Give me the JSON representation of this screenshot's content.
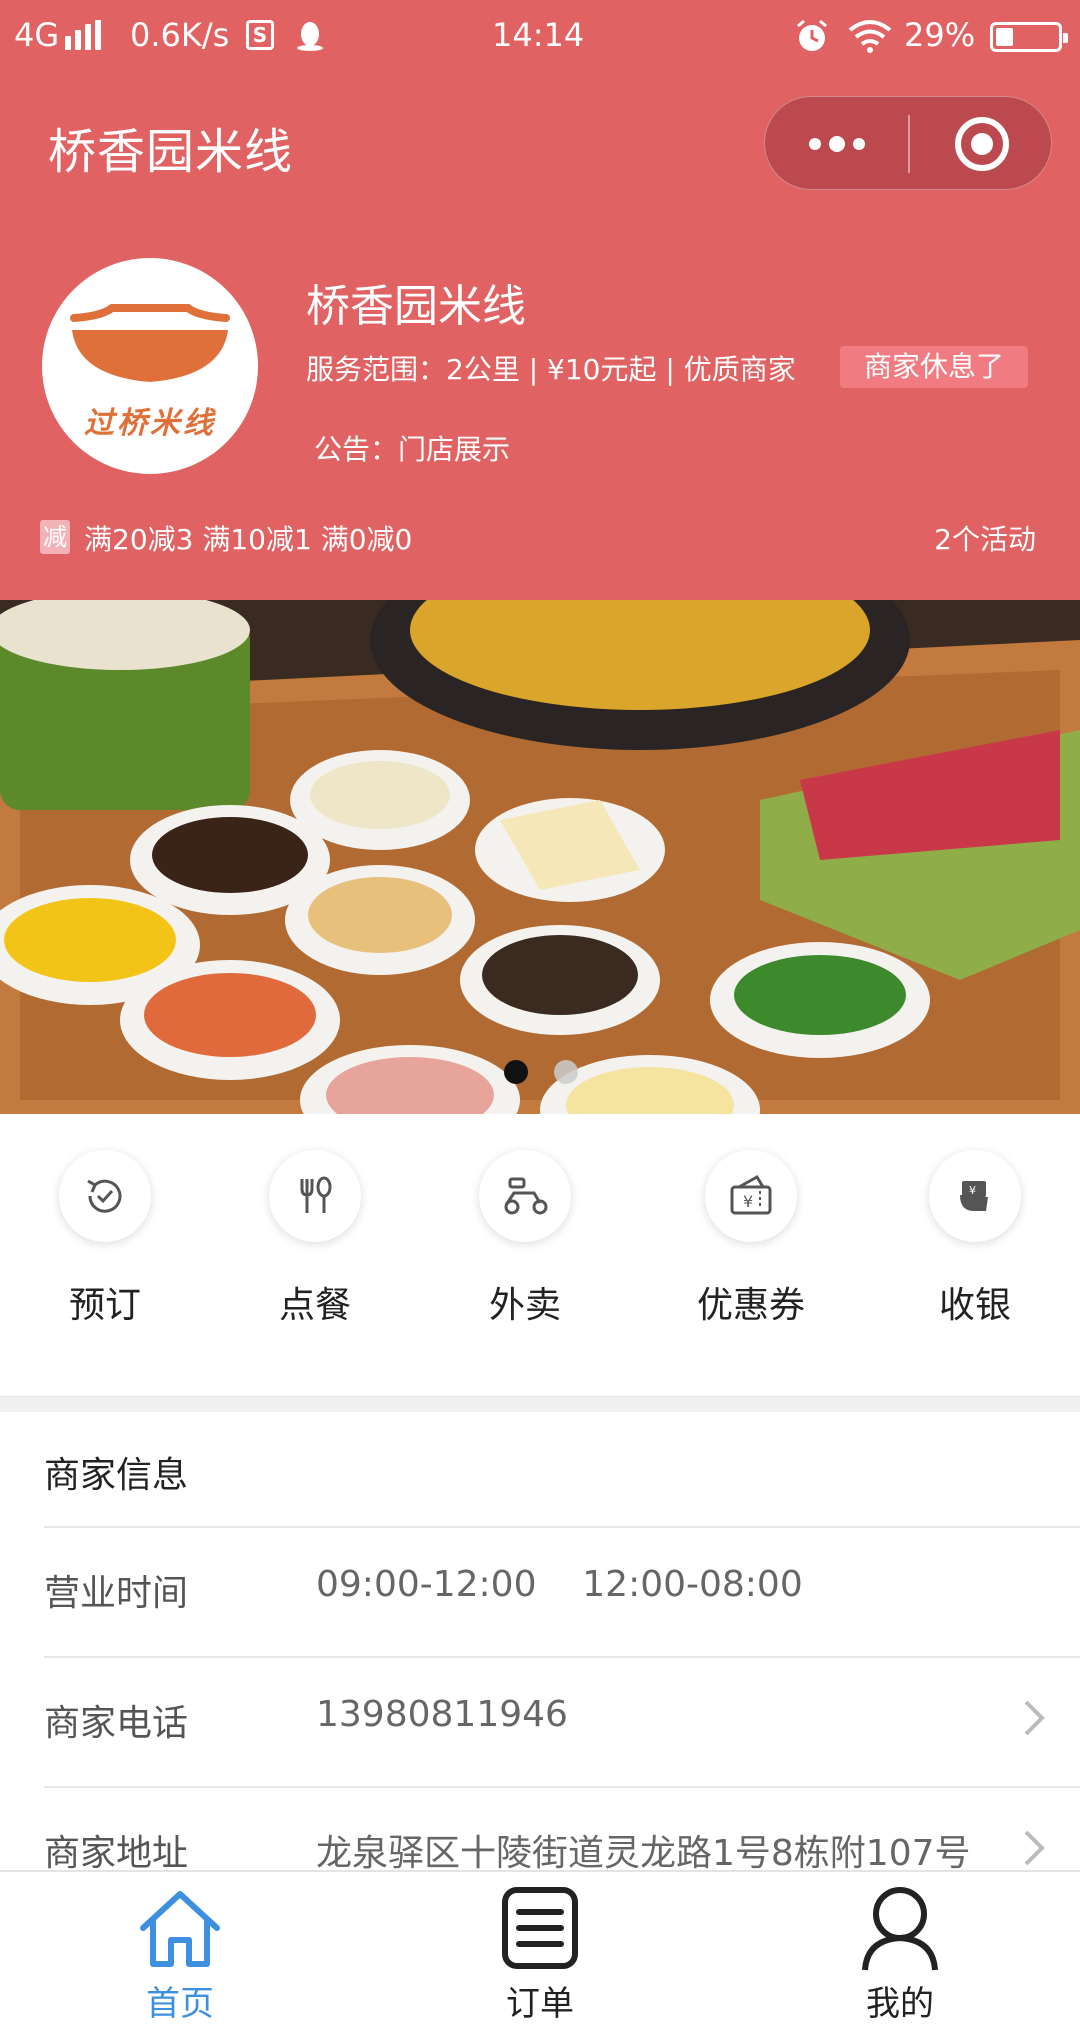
{
  "status_bar": {
    "network": "4G",
    "speed": "0.6K/s",
    "s_badge": "S",
    "time": "14:14",
    "battery": "29%",
    "battery_level": 0.29
  },
  "navbar": {
    "title": "桥香园米线"
  },
  "shop": {
    "logo_text": "过桥米线",
    "name": "桥香园米线",
    "meta": "服务范围：2公里 | ¥10元起 | 优质商家",
    "status_badge": "商家休息了",
    "notice": "公告：门店展示"
  },
  "promotions": {
    "tag": "减",
    "text": "满20减3  满10减1  满0减0",
    "count": "2个活动"
  },
  "banner": {
    "page_count": 2,
    "active_page": 1
  },
  "actions": [
    {
      "label": "预订",
      "icon": "clock-check-icon"
    },
    {
      "label": "点餐",
      "icon": "fork-spoon-icon"
    },
    {
      "label": "外卖",
      "icon": "scooter-icon"
    },
    {
      "label": "优惠券",
      "icon": "coupon-icon"
    },
    {
      "label": "收银",
      "icon": "cashier-icon"
    }
  ],
  "merchant_info": {
    "title": "商家信息",
    "rows": [
      {
        "key": "营业时间",
        "value": "09:00-12:00    12:00-08:00"
      },
      {
        "key": "商家电话",
        "value": "13980811946"
      },
      {
        "key": "商家地址",
        "value": "龙泉驿区十陵街道灵龙路1号8栋附107号"
      }
    ]
  },
  "tabbar": {
    "tabs": [
      {
        "label": "首页",
        "icon": "home-icon",
        "active": true
      },
      {
        "label": "订单",
        "icon": "order-list-icon",
        "active": false
      },
      {
        "label": "我的",
        "icon": "user-icon",
        "active": false
      }
    ]
  },
  "colors": {
    "header_bg": "#e06262",
    "badge_bg": "#f07c82",
    "active_tab": "#3d8fe0"
  }
}
